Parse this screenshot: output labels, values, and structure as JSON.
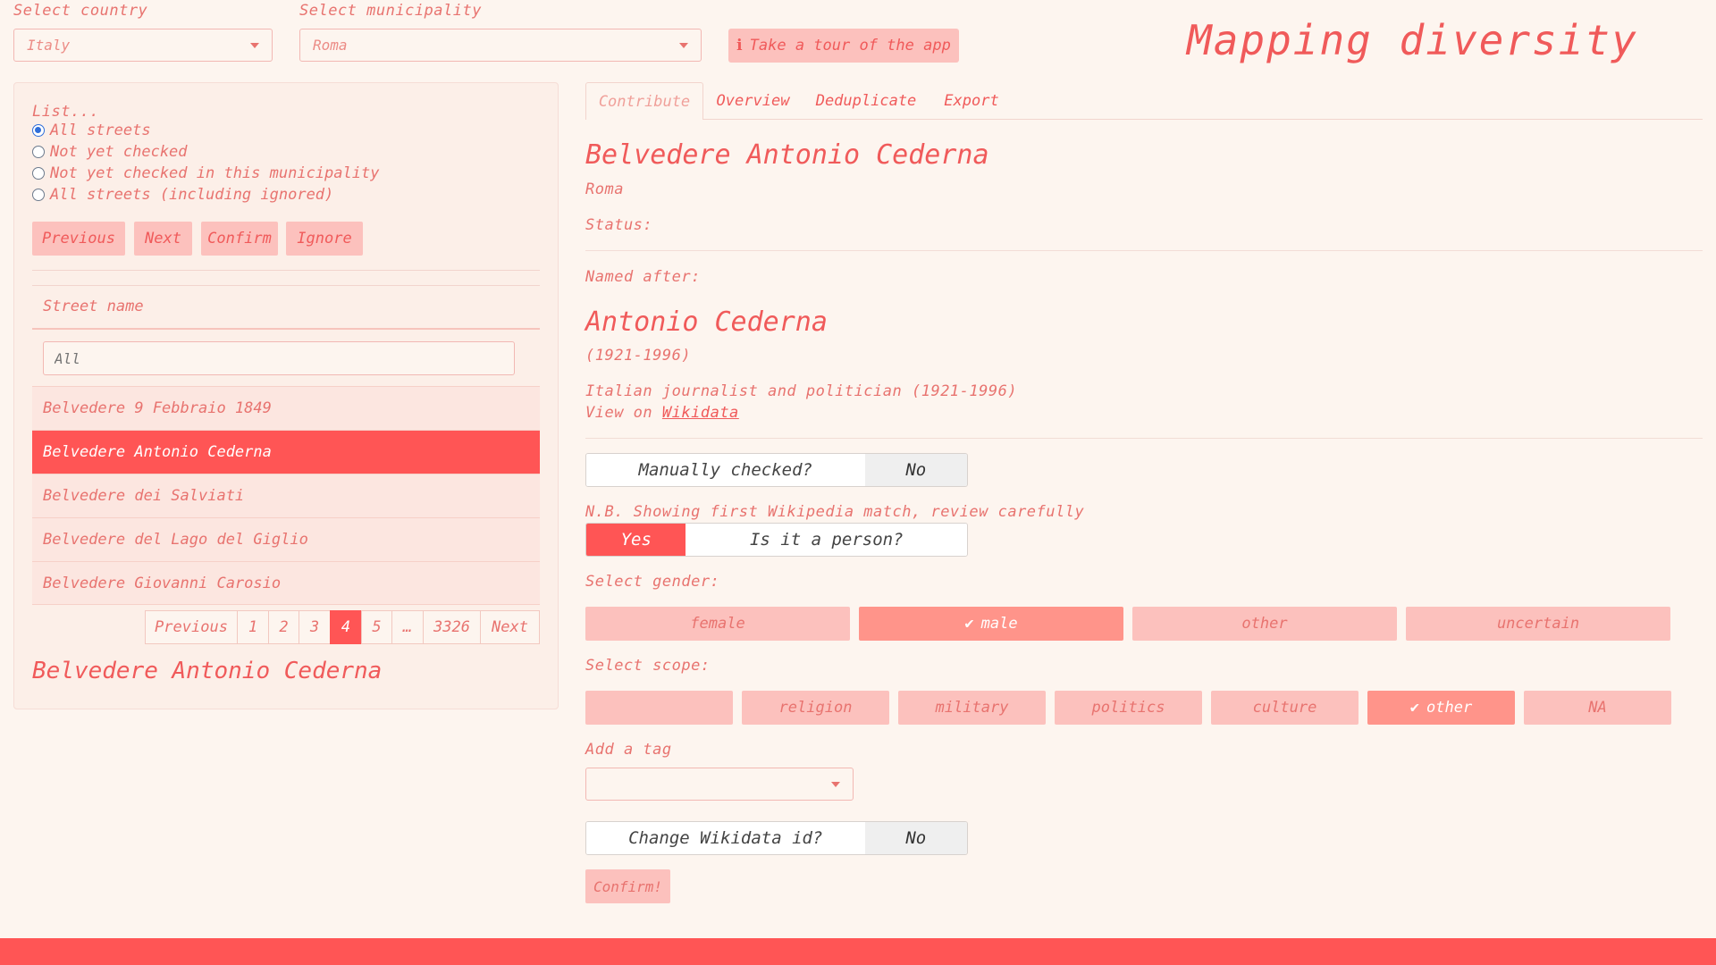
{
  "top": {
    "country_label": "Select country",
    "country_value": "Italy",
    "municipality_label": "Select municipality",
    "municipality_value": "Roma",
    "tour_button": "Take a tour of the app",
    "app_title": "Mapping diversity"
  },
  "sidebar": {
    "list_label": "List...",
    "radios": [
      {
        "label": "All streets",
        "selected": true
      },
      {
        "label": "Not yet checked",
        "selected": false
      },
      {
        "label": "Not yet checked in this municipality",
        "selected": false
      },
      {
        "label": "All streets (including ignored)",
        "selected": false
      }
    ],
    "buttons": {
      "previous": "Previous",
      "next": "Next",
      "confirm": "Confirm",
      "ignore": "Ignore"
    },
    "table": {
      "column_header": "Street name",
      "filter_placeholder": "All",
      "rows": [
        "Belvedere 9 Febbraio 1849",
        "Belvedere Antonio Cederna",
        "Belvedere dei Salviati",
        "Belvedere del Lago del Giglio",
        "Belvedere Giovanni Carosio"
      ],
      "selected_index": 1
    },
    "pagination": {
      "previous": "Previous",
      "pages": [
        "1",
        "2",
        "3",
        "4",
        "5",
        "…",
        "3326"
      ],
      "active": "4",
      "next": "Next"
    },
    "selected_street": "Belvedere Antonio Cederna"
  },
  "tabs": [
    "Contribute",
    "Overview",
    "Deduplicate",
    "Export"
  ],
  "detail": {
    "street_name": "Belvedere Antonio Cederna",
    "municipality": "Roma",
    "status_label": "Status:",
    "named_after_label": "Named after:",
    "person_name": "Antonio Cederna",
    "person_years": "(1921-1996)",
    "person_description": "Italian journalist and politician (1921-1996)",
    "view_on": "View on",
    "wikidata_link": "Wikidata",
    "manually_checked": {
      "label": "Manually checked?",
      "value": "No"
    },
    "nb_note": "N.B. Showing first Wikipedia match, review carefully",
    "is_person": {
      "value": "Yes",
      "label": "Is it a person?"
    },
    "gender_label": "Select gender:",
    "gender_options": [
      "female",
      "male",
      "other",
      "uncertain"
    ],
    "gender_selected": "male",
    "scope_label": "Select scope:",
    "scope_options": [
      "",
      "religion",
      "military",
      "politics",
      "culture",
      "other",
      "NA"
    ],
    "scope_selected": "other",
    "tag_label": "Add a tag",
    "change_wikidata": {
      "label": "Change Wikidata id?",
      "value": "No"
    },
    "confirm_button": "Confirm!"
  },
  "colors": {
    "accent": "#ff5555",
    "background": "#fdf5ef",
    "soft_button": "#fcc1bd",
    "selected_button": "#ff948a"
  }
}
